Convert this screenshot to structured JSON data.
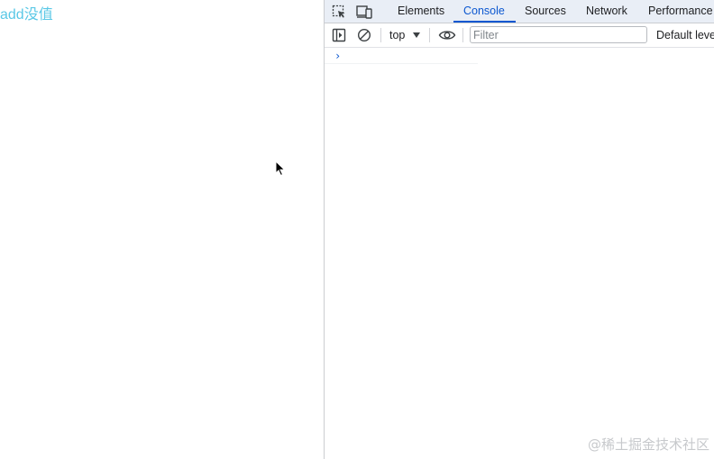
{
  "page": {
    "link_text": "add没值"
  },
  "devtools": {
    "tabs": [
      {
        "label": "Elements",
        "active": false
      },
      {
        "label": "Console",
        "active": true
      },
      {
        "label": "Sources",
        "active": false
      },
      {
        "label": "Network",
        "active": false
      },
      {
        "label": "Performance",
        "active": false
      }
    ],
    "toolbar": {
      "context": "top",
      "filter_placeholder": "Filter",
      "levels_label": "Default levels"
    },
    "console": {
      "prompt_symbol": "›"
    }
  },
  "watermark": "@稀土掘金技术社区",
  "icons": {
    "inspect": "inspect-element-icon",
    "device": "device-toggle-icon",
    "sidebar": "sidebar-toggle-icon",
    "clear": "clear-console-icon",
    "eye": "live-expression-eye-icon",
    "cursor": "mouse-cursor-icon"
  },
  "colors": {
    "accent": "#0b57d0",
    "link": "#5ac8e6",
    "tabbar_bg": "#e9eef6"
  }
}
